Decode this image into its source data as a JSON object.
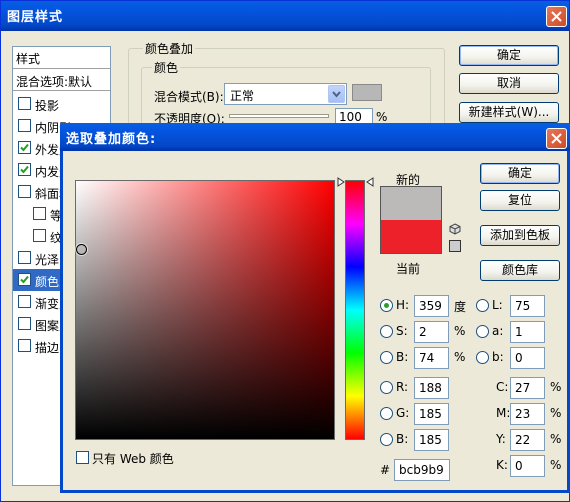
{
  "layer_style": {
    "title": "图层样式",
    "styles_header": "样式",
    "blend_options": "混合选项:默认",
    "sidebar": [
      {
        "label": "投影",
        "checked": false,
        "indent": false
      },
      {
        "label": "内阴影",
        "checked": false,
        "indent": false
      },
      {
        "label": "外发光",
        "checked": true,
        "indent": false
      },
      {
        "label": "内发光",
        "checked": true,
        "indent": false
      },
      {
        "label": "斜面和浮雕",
        "checked": false,
        "indent": false
      },
      {
        "label": "等高线",
        "checked": false,
        "indent": true
      },
      {
        "label": "纹理",
        "checked": false,
        "indent": true
      },
      {
        "label": "光泽",
        "checked": false,
        "indent": false
      },
      {
        "label": "颜色叠加",
        "checked": true,
        "indent": false,
        "selected": true
      },
      {
        "label": "渐变叠加",
        "checked": false,
        "indent": false
      },
      {
        "label": "图案叠加",
        "checked": false,
        "indent": false
      },
      {
        "label": "描边",
        "checked": false,
        "indent": false
      }
    ],
    "section_title": "颜色叠加",
    "group_title": "颜色",
    "blend_mode_label": "混合模式(B):",
    "blend_mode_value": "正常",
    "opacity_label": "不透明度(O):",
    "opacity_value": "100",
    "opacity_unit": "%",
    "ok_label": "确定",
    "cancel_label": "取消",
    "new_style_label": "新建样式(W)..."
  },
  "picker": {
    "title": "选取叠加颜色:",
    "new_label": "新的",
    "current_label": "当前",
    "ok_label": "确定",
    "reset_label": "复位",
    "add_swatch_label": "添加到色板",
    "color_library_label": "颜色库",
    "web_only_label": "只有 Web 颜色",
    "web_only_checked": false,
    "new_color": "#bcb9b9",
    "current_color": "#ed2129",
    "hue_color": "#ff0000",
    "fields": {
      "H": {
        "label": "H:",
        "value": "359",
        "unit": "度"
      },
      "S": {
        "label": "S:",
        "value": "2",
        "unit": "%"
      },
      "Bv": {
        "label": "B:",
        "value": "74",
        "unit": "%"
      },
      "R": {
        "label": "R:",
        "value": "188"
      },
      "G": {
        "label": "G:",
        "value": "185"
      },
      "Bb": {
        "label": "B:",
        "value": "185"
      },
      "L": {
        "label": "L:",
        "value": "75"
      },
      "a": {
        "label": "a:",
        "value": "1"
      },
      "b": {
        "label": "b:",
        "value": "0"
      },
      "C": {
        "label": "C:",
        "value": "27",
        "unit": "%"
      },
      "M": {
        "label": "M:",
        "value": "23",
        "unit": "%"
      },
      "Y": {
        "label": "Y:",
        "value": "22",
        "unit": "%"
      },
      "K": {
        "label": "K:",
        "value": "0",
        "unit": "%"
      }
    },
    "hex_label": "#",
    "hex_value": "bcb9b9",
    "selected_mode": "H"
  }
}
